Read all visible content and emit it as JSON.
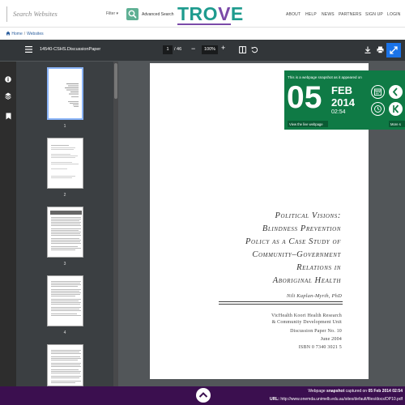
{
  "header": {
    "search_placeholder": "Search Websites",
    "filter_label": "Filter",
    "advanced_label": "Advanced Search",
    "logo": {
      "t": "TR",
      "o": "O",
      "v": "V",
      "e": "E"
    },
    "nav": [
      "ABOUT",
      "HELP",
      "NEWS",
      "PARTNERS",
      "SIGN UP",
      "LOGIN"
    ]
  },
  "breadcrumb": {
    "home": "Home",
    "sep": "/",
    "current": "Websites"
  },
  "toolbar": {
    "filename": "14540-CSHS.DiscussionPaper",
    "page_current": "1",
    "page_total": "/ 46",
    "zoom": "100%"
  },
  "thumbnails": {
    "labels": [
      "1",
      "2",
      "3",
      "4"
    ]
  },
  "document": {
    "title_lines": [
      "Political Visions:",
      "Blindness Prevention",
      "Policy as a Case Study of",
      "Community–Government",
      "Relations in",
      "Aboriginal Health"
    ],
    "author": "Nili Kaplan-Myrth, PhD",
    "publisher_lines": [
      "VicHealth Koori Health Research",
      "& Community Development Unit"
    ],
    "paper": "Discussion Paper No. 10",
    "date": "June 2004",
    "isbn": "ISBN 0 7340 3021 5"
  },
  "snapshot": {
    "caption": "This is a webpage snapshot as it appeared on",
    "day": "05",
    "month": "FEB",
    "year": "2014",
    "time": "02:54",
    "live_label": "View the live webpage",
    "more_label": "More s"
  },
  "footer": {
    "line1_prefix": "Webpage ",
    "line1_bold": "snapshot",
    "line1_mid": " captured on ",
    "line1_date": "05 Feb 2014 02:54",
    "url_label": "URL:",
    "url": " http://www.onemda.unimelb.edu.au/sites/default/files/docs/DP10.pdf"
  },
  "colors": {
    "brand_teal": "#1e9b8e",
    "brand_purple": "#7b4aa8",
    "banner_green": "#0f7a45",
    "footer_purple": "#3b0f4f"
  }
}
